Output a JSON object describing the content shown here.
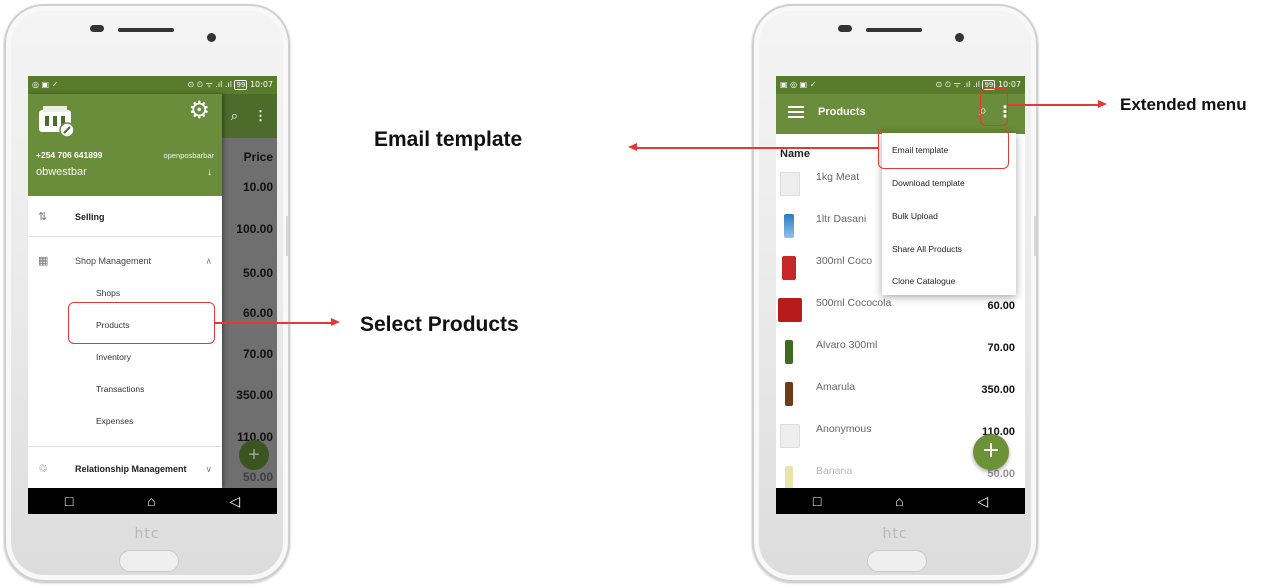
{
  "left_phone": {
    "status": {
      "left_icons": "◎ ▣ ✓",
      "right_icons": "⊙ ⏲ ᯤ .ıl .ıl",
      "battery": "99",
      "time": "10:07"
    },
    "background": {
      "price_header": "Price",
      "prices": [
        "10.00",
        "100.00",
        "50.00",
        "60.00",
        "70.00",
        "350.00",
        "110.00",
        "50.00"
      ]
    },
    "drawer": {
      "phone_number": "+254 706 641899",
      "bar_tag": "openposbarbar",
      "shop_name": "obwestbar",
      "menu": {
        "selling": "Selling",
        "shop_management": "Shop Management",
        "relationship_management": "Relationship Management"
      },
      "submenu": [
        "Shops",
        "Products",
        "Inventory",
        "Transactions",
        "Expenses"
      ]
    },
    "brand": "htc"
  },
  "right_phone": {
    "status": {
      "left_icons": "▣ ◎ ▣ ✓",
      "right_icons": "⊙ ⏲ ᯤ .ıl .ıl",
      "battery": "99",
      "time": "10:07"
    },
    "toolbar": {
      "title": "Products"
    },
    "list_header": "Name",
    "products": [
      {
        "name": "1kg Meat",
        "price": ""
      },
      {
        "name": "1ltr Dasani",
        "price": ""
      },
      {
        "name": "300ml Coco",
        "price": ""
      },
      {
        "name": "500ml Cococola",
        "price": "60.00"
      },
      {
        "name": "Alvaro 300ml",
        "price": "70.00"
      },
      {
        "name": "Amarula",
        "price": "350.00"
      },
      {
        "name": "Anonymous",
        "price": "110.00"
      },
      {
        "name": "Banana",
        "price": "50.00"
      }
    ],
    "overflow_menu": [
      "Email template",
      "Download template",
      "Bulk Upload",
      "Share All Products",
      "Clone Catalogue"
    ],
    "brand": "htc"
  },
  "annotations": {
    "email_template": "Email template",
    "select_products": "Select Products",
    "extended_menu": "Extended menu"
  },
  "colors": {
    "brand_green": "#698d3a",
    "annotation_red": "#e53935"
  }
}
